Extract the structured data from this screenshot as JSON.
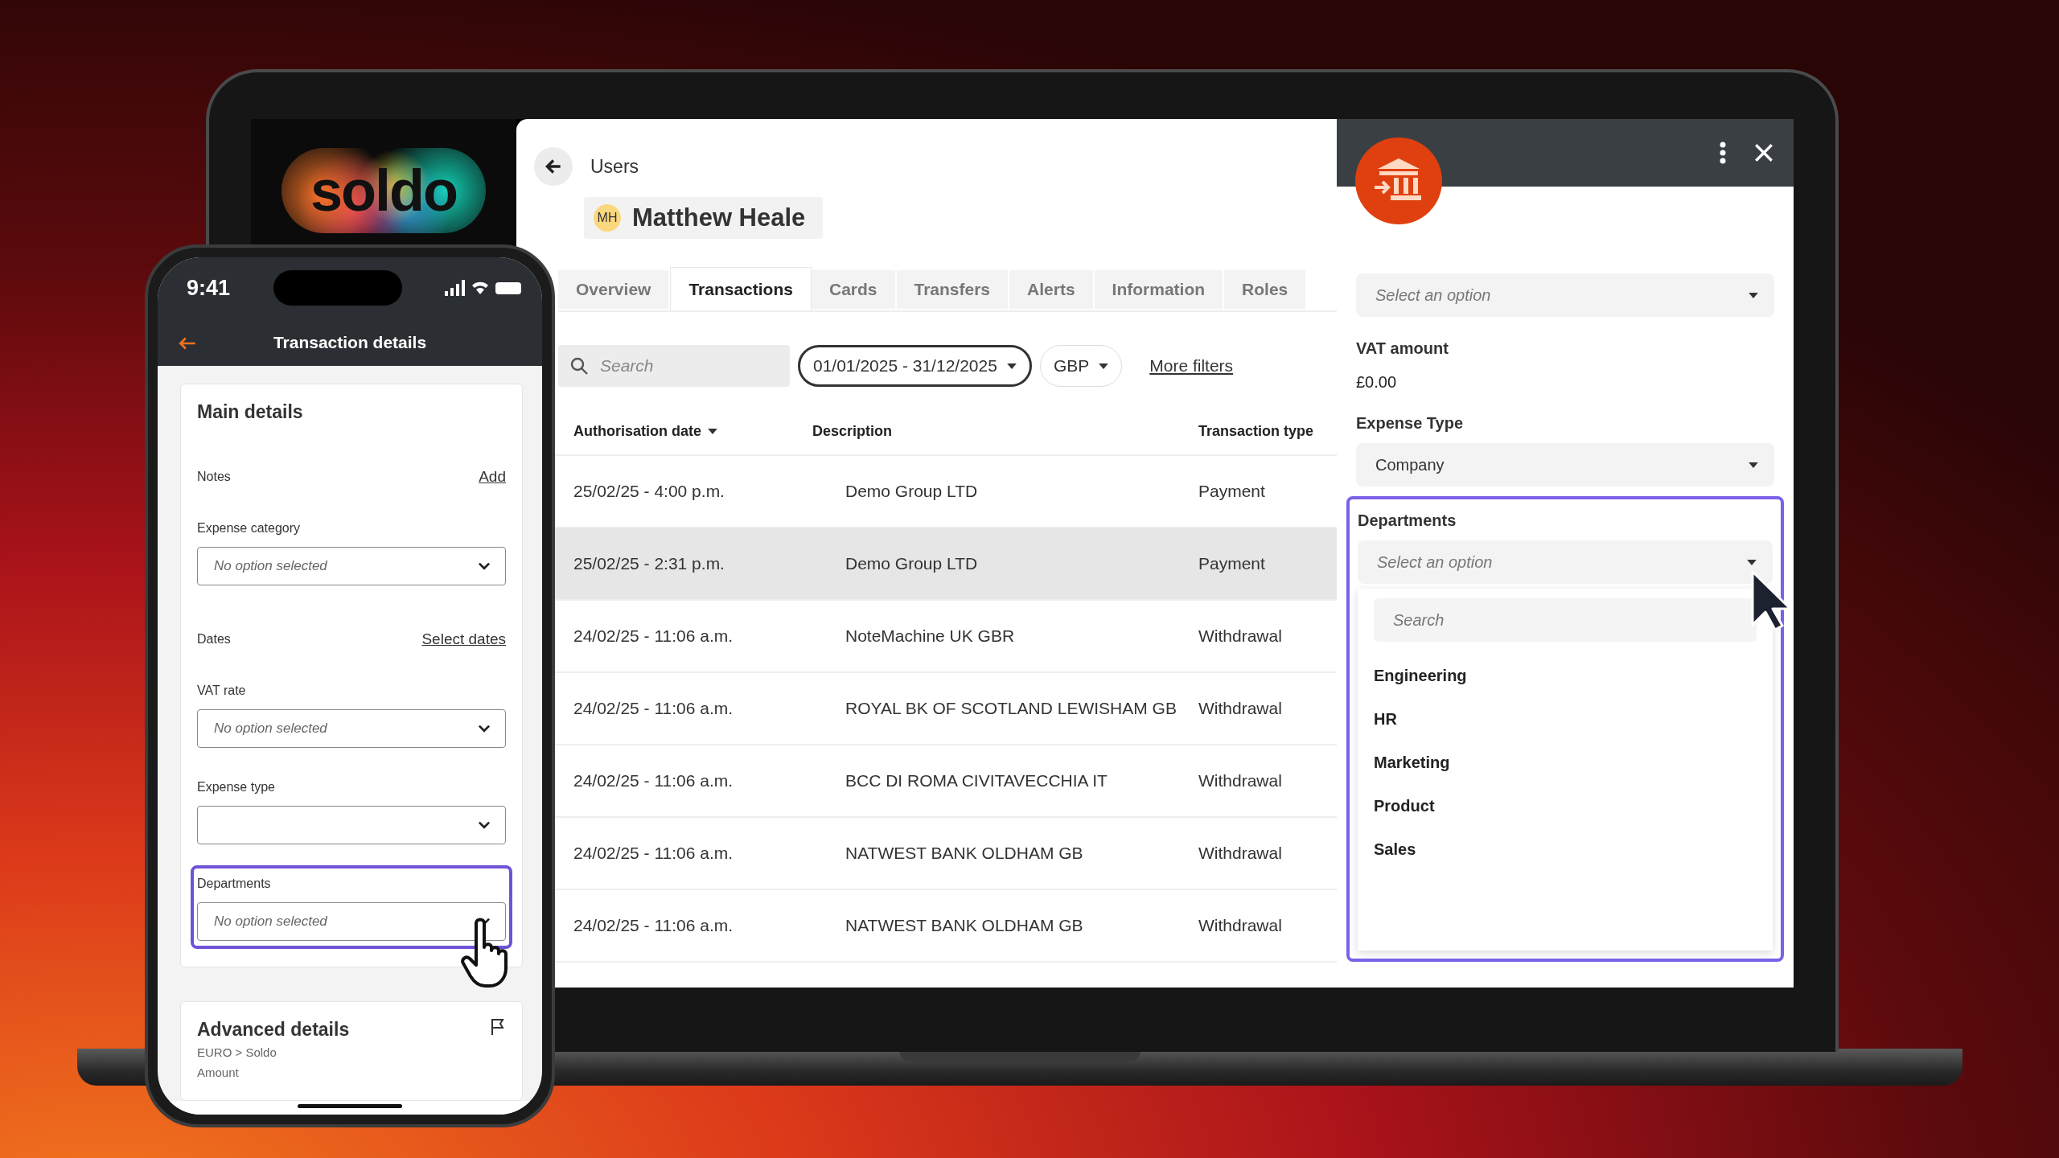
{
  "laptop": {
    "logo": "soldo",
    "header": {
      "back_label": "Users",
      "user": {
        "initials": "MH",
        "name": "Matthew Heale"
      }
    },
    "tabs": [
      {
        "label": "Overview",
        "selected": false
      },
      {
        "label": "Transactions",
        "selected": true
      },
      {
        "label": "Cards",
        "selected": false
      },
      {
        "label": "Transfers",
        "selected": false
      },
      {
        "label": "Alerts",
        "selected": false
      },
      {
        "label": "Information",
        "selected": false
      },
      {
        "label": "Roles",
        "selected": false
      }
    ],
    "filters": {
      "search": {
        "placeholder": "Search"
      },
      "date_range": "01/01/2025 - 31/12/2025",
      "currency": "GBP",
      "more_filters": "More filters"
    },
    "table": {
      "columns": [
        {
          "label": "Authorisation date",
          "sorted": true
        },
        {
          "label": "Description",
          "sorted": false
        },
        {
          "label": "Transaction type",
          "sorted": false
        }
      ],
      "rows": [
        {
          "cells": [
            "25/02/25 - 4:00 p.m.",
            "Demo Group LTD",
            "Payment"
          ],
          "highlighted": false
        },
        {
          "cells": [
            "25/02/25 - 2:31 p.m.",
            "Demo Group LTD",
            "Payment"
          ],
          "highlighted": true
        },
        {
          "cells": [
            "24/02/25 - 11:06 a.m.",
            "NoteMachine UK GBR",
            "Withdrawal"
          ],
          "highlighted": false
        },
        {
          "cells": [
            "24/02/25 - 11:06 a.m.",
            "ROYAL BK OF SCOTLAND LEWISHAM GB",
            "Withdrawal"
          ],
          "highlighted": false
        },
        {
          "cells": [
            "24/02/25 - 11:06 a.m.",
            "BCC DI ROMA CIVITAVECCHIA IT",
            "Withdrawal"
          ],
          "highlighted": false
        },
        {
          "cells": [
            "24/02/25 - 11:06 a.m.",
            "NATWEST BANK OLDHAM GB",
            "Withdrawal"
          ],
          "highlighted": false
        },
        {
          "cells": [
            "24/02/25 - 11:06 a.m.",
            "NATWEST BANK OLDHAM GB",
            "Withdrawal"
          ],
          "highlighted": false
        }
      ]
    },
    "side_panel": {
      "fields": [
        {
          "kind": "select",
          "placeholder": "Select an option",
          "highlighted": false,
          "expanded": false
        },
        {
          "kind": "amount",
          "label": "VAT amount",
          "value": "£0.00",
          "highlighted": false
        },
        {
          "kind": "select",
          "label": "Expense Type",
          "value": "Company",
          "highlighted": false,
          "expanded": false
        },
        {
          "kind": "select",
          "label": "Departments",
          "placeholder": "Select an option",
          "highlighted": true,
          "expanded": true,
          "search_placeholder": "Search",
          "options": [
            "Engineering",
            "HR",
            "Marketing",
            "Product",
            "Sales"
          ]
        }
      ]
    }
  },
  "phone": {
    "status_bar": {
      "time": "9:41"
    },
    "title": "Transaction details",
    "main_card": {
      "title": "Main details",
      "fields": [
        {
          "kind": "link",
          "label": "Notes",
          "action": "Add",
          "highlighted": false
        },
        {
          "kind": "select",
          "label": "Expense category",
          "placeholder": "No option selected",
          "highlighted": false
        },
        {
          "kind": "link",
          "label": "Dates",
          "action": "Select dates",
          "highlighted": false
        },
        {
          "kind": "select",
          "label": "VAT rate",
          "placeholder": "No option selected",
          "highlighted": false
        },
        {
          "kind": "select",
          "label": "Expense type",
          "highlighted": false
        },
        {
          "kind": "select",
          "label": "Departments",
          "placeholder": "No option selected",
          "highlighted": true
        }
      ]
    },
    "advanced_card": {
      "title": "Advanced details",
      "subtitle": "EURO > Soldo",
      "label": "Amount"
    }
  }
}
